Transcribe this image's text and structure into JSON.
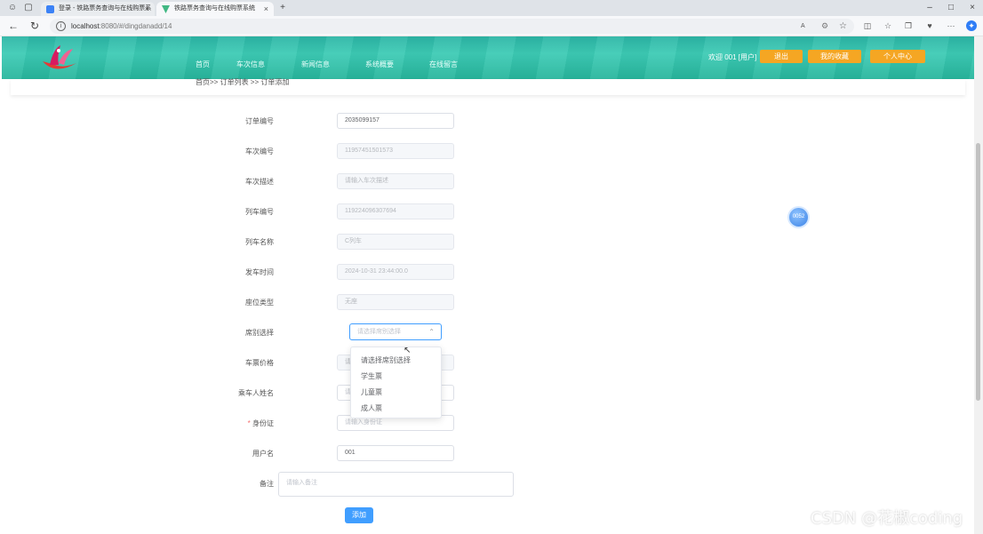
{
  "browser": {
    "tabs": [
      {
        "title": "登录 - 铁路票务查询与在线购票系"
      },
      {
        "title": "铁路票务查询与在线购票系统"
      }
    ],
    "url_host": "localhost",
    "url_rest": ":8080/#/dingdanadd/14",
    "reader_label": "A"
  },
  "header": {
    "nav": [
      "首页",
      "车次信息",
      "新闻信息",
      "系统概要",
      "在线留言"
    ],
    "welcome": "欢迎 001 [用户]",
    "logout_label": "退出",
    "favorites_label": "我的收藏",
    "profile_label": "个人中心"
  },
  "breadcrumb": "首页>> 订单列表 >> 订单添加",
  "form": {
    "fields": [
      {
        "label": "订单编号",
        "value": "2035099157"
      },
      {
        "label": "车次编号",
        "value": "11957451501573"
      },
      {
        "label": "车次描述",
        "value": "请输入车次描述"
      },
      {
        "label": "列车编号",
        "value": "119224096307694"
      },
      {
        "label": "列车名称",
        "value": "C列车"
      },
      {
        "label": "发车时间",
        "value": "2024-10-31 23:44:00.0"
      },
      {
        "label": "座位类型",
        "value": "无座"
      },
      {
        "label": "席别选择",
        "value": "请选择席别选择"
      },
      {
        "label": "车票价格",
        "value": "请"
      },
      {
        "label": "乘车人姓名",
        "value": "请"
      },
      {
        "label": "身份证",
        "value": "请输入身份证"
      },
      {
        "label": "用户名",
        "value": "001"
      },
      {
        "label": "备注",
        "value": "请输入备注"
      }
    ],
    "select_options": [
      "请选择席别选择",
      "学生票",
      "儿童票",
      "成人票"
    ],
    "submit_label": "添加"
  },
  "float_button_label": "0052",
  "watermark": "CSDN @花椒coding",
  "colors": {
    "primary": "#409eff",
    "header_teal": "#2cb5a5",
    "header_button": "#f5a623"
  }
}
